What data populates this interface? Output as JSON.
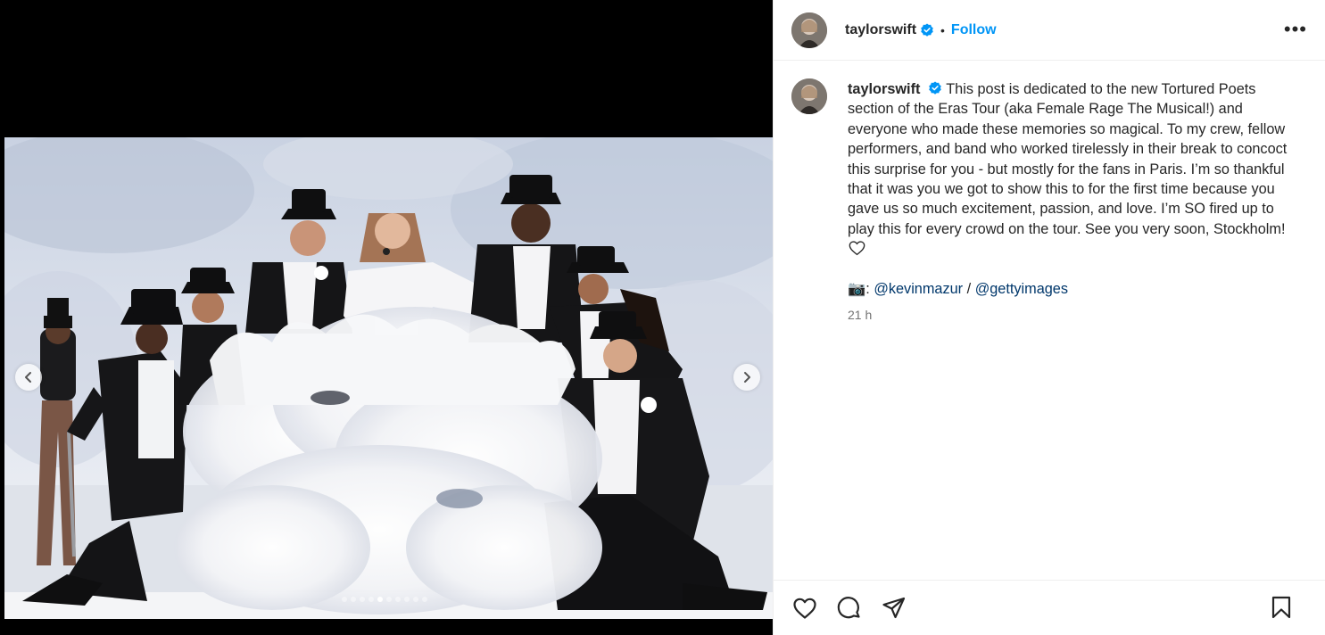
{
  "post": {
    "username": "taylorswift",
    "follow_label": "Follow",
    "separator": "•",
    "more_label": "•••",
    "caption": "This post is dedicated to the new Tortured Poets section of the Eras Tour (aka Female Rage The Musical!) and everyone who made these memories so magical. To my crew, fellow performers, and band who worked tirelessly in their break to concoct this surprise for you - but mostly for the fans in Paris. I’m so thankful that it was you we got to show this to for the first time because you gave us so much excitement, passion, and love. I’m SO fired up to play this for every crowd on the tour. See you very soon, Stockholm!",
    "credit_prefix": "📷: ",
    "credit_mention_1": "@kevinmazur",
    "credit_sep": " / ",
    "credit_mention_2": "@gettyimages",
    "timestamp": "21 h"
  },
  "carousel": {
    "slide_count": 10,
    "active_index": 4
  },
  "icons": {
    "verified": "verified-badge-icon",
    "more": "more-options-icon",
    "like": "heart-icon",
    "comment": "comment-icon",
    "share": "share-icon",
    "save": "bookmark-icon",
    "prev": "chevron-left-icon",
    "next": "chevron-right-icon"
  },
  "colors": {
    "accent": "#0095f6",
    "mention": "#00376b",
    "muted": "#737373",
    "verified": "#0095f6"
  }
}
